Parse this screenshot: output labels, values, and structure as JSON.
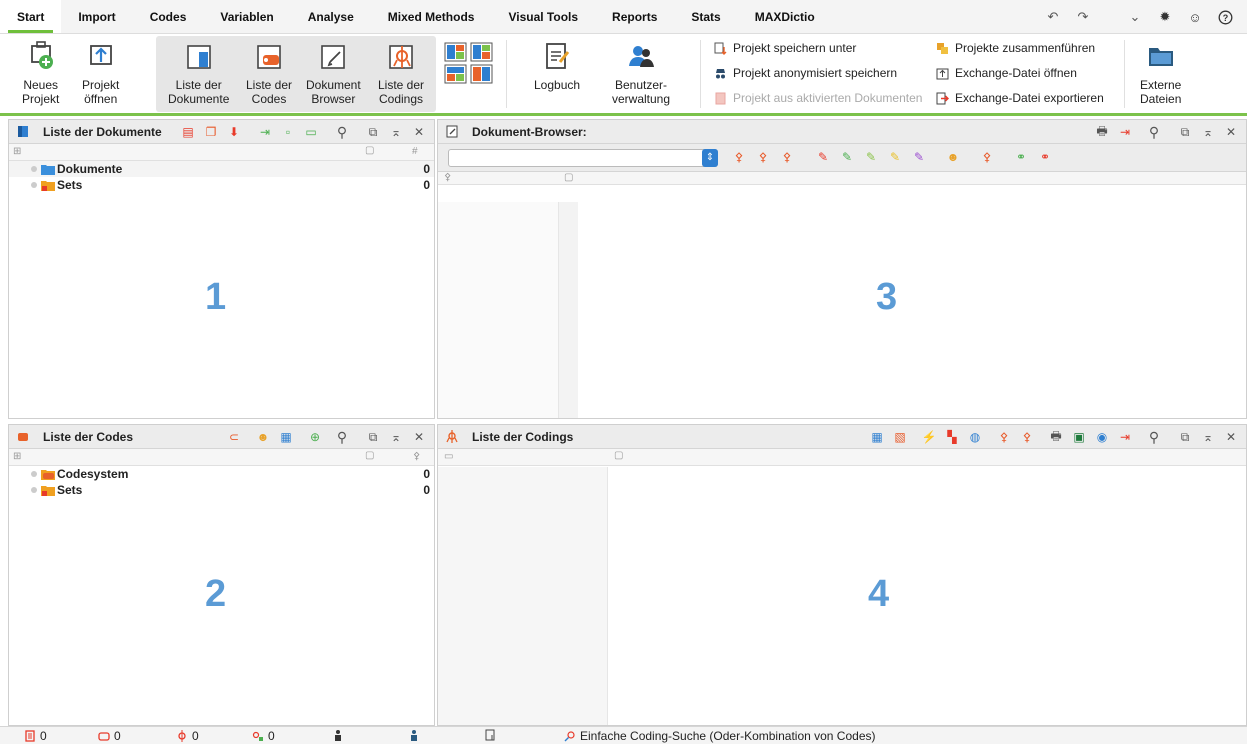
{
  "menu": {
    "tabs": [
      "Start",
      "Import",
      "Codes",
      "Variablen",
      "Analyse",
      "Mixed Methods",
      "Visual Tools",
      "Reports",
      "Stats",
      "MAXDictio"
    ],
    "right_icons": [
      "undo-icon",
      "redo-icon",
      "chevron-down-icon",
      "gear-icon",
      "smiley-icon",
      "help-icon"
    ]
  },
  "ribbon": {
    "neues_projekt": [
      "Neues",
      "Projekt"
    ],
    "projekt_oeffnen": [
      "Projekt",
      "öffnen"
    ],
    "liste_dokumente": [
      "Liste der",
      "Dokumente"
    ],
    "liste_codes": [
      "Liste der",
      "Codes"
    ],
    "dokument_browser": [
      "Dokument",
      "Browser"
    ],
    "liste_codings": [
      "Liste der",
      "Codings"
    ],
    "logbuch": "Logbuch",
    "benutzerverwaltung": [
      "Benutzer-",
      "verwaltung"
    ],
    "projekt_speichern_unter": "Projekt speichern unter",
    "projekt_anonymisiert": "Projekt anonymisiert speichern",
    "projekt_aus_aktivierten": "Projekt aus aktivierten Dokumenten",
    "projekte_zusammenfuehren": "Projekte zusammenführen",
    "exchange_oeffnen": "Exchange-Datei öffnen",
    "exchange_exportieren": "Exchange-Datei exportieren",
    "externe_dateien": [
      "Externe",
      "Dateien"
    ]
  },
  "panels": {
    "dokumente": {
      "title": "Liste der Dokumente",
      "col_count": "#",
      "items": [
        {
          "label": "Dokumente",
          "count": "0"
        },
        {
          "label": "Sets",
          "count": "0"
        }
      ],
      "number": "1"
    },
    "browser": {
      "title": "Dokument-Browser:",
      "number": "3"
    },
    "codes": {
      "title": "Liste der Codes",
      "items": [
        {
          "label": "Codesystem",
          "count": "0"
        },
        {
          "label": "Sets",
          "count": "0"
        }
      ],
      "number": "2"
    },
    "codings": {
      "title": "Liste der Codings",
      "number": "4"
    }
  },
  "status": {
    "docs": "0",
    "codes": "0",
    "codings": "0",
    "memos": "0",
    "search": "Einfache Coding-Suche (Oder-Kombination von Codes)"
  },
  "colors": {
    "accent_green": "#7cc24b",
    "number_blue": "#5b9bd5",
    "code_orange": "#e8622a",
    "doc_blue": "#2f7fd0"
  }
}
